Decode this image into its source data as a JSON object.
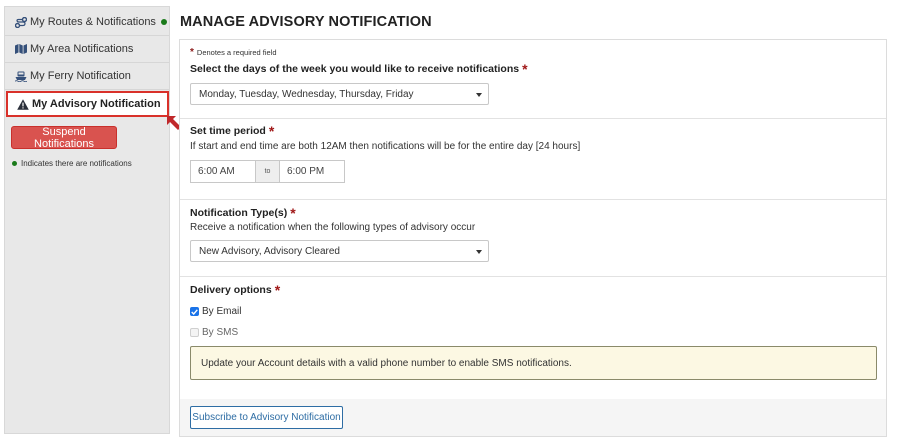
{
  "sidebar": {
    "items": [
      {
        "label": "My Routes & Notifications",
        "icon": "routes-icon",
        "has_notifications": true
      },
      {
        "label": "My Area Notifications",
        "icon": "map-icon"
      },
      {
        "label": "My Ferry Notification",
        "icon": "ferry-icon"
      },
      {
        "label": "My Advisory Notification",
        "icon": "warning-icon",
        "active": true
      }
    ],
    "suspend_label": "Suspend Notifications",
    "legend_text": "Indicates there are notifications"
  },
  "page": {
    "title": "MANAGE ADVISORY NOTIFICATION",
    "required_note": "Denotes a required field",
    "required_marker": "*"
  },
  "days": {
    "label": "Select the days of the week you would like to receive notifications",
    "selected": "Monday, Tuesday, Wednesday, Thursday, Friday"
  },
  "time": {
    "label": "Set time period",
    "help": "If start and end time are both 12AM then notifications will be for the entire day [24 hours]",
    "start": "6:00 AM",
    "separator": "to",
    "end": "6:00 PM"
  },
  "types": {
    "label": "Notification Type(s)",
    "help": "Receive a notification when the following types of advisory occur",
    "selected": "New Advisory, Advisory Cleared"
  },
  "delivery": {
    "label": "Delivery options",
    "email_label": "By Email",
    "email_checked": true,
    "sms_label": "By SMS",
    "sms_checked": false,
    "sms_notice": "Update your Account details with a valid phone number to enable SMS notifications."
  },
  "footer": {
    "subscribe_label": "Subscribe to Advisory Notification"
  },
  "colors": {
    "accent_red": "#d9312a",
    "suspend_button": "#d9534f",
    "notification_dot": "#1a7a1a",
    "primary_blue": "#2e6da4",
    "notice_bg": "#fcf8e3"
  }
}
